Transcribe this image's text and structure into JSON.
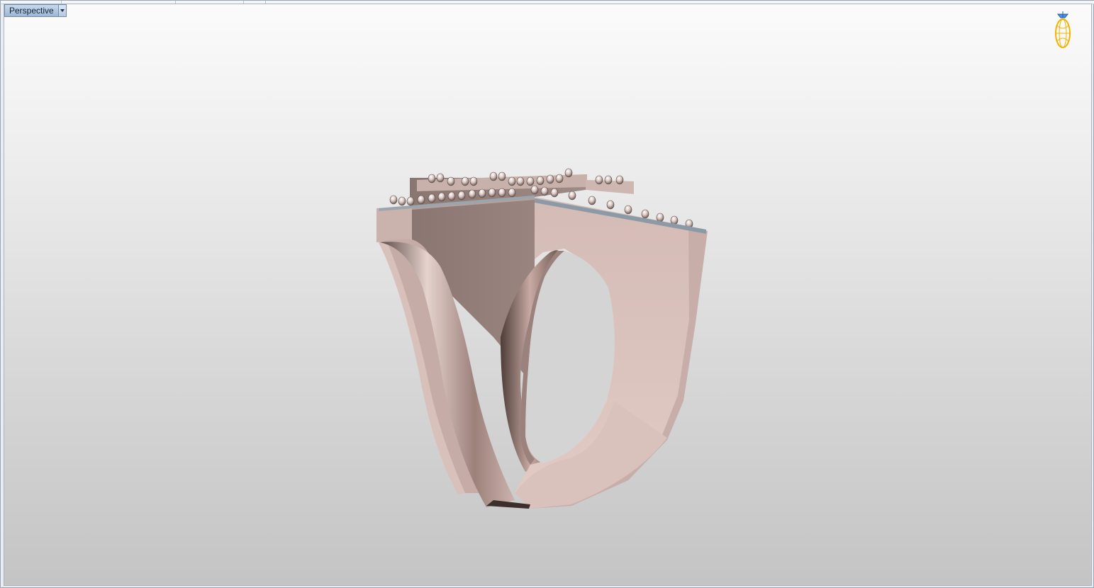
{
  "viewport": {
    "title": "Perspective",
    "dropdown_icon": "chevron-down-icon",
    "gumball_icon": "ring-gumball-icon",
    "model": "ring-3d-model"
  },
  "colors": {
    "metal_light": "#dcc3bd",
    "metal_mid": "#b89f9a",
    "metal_dark": "#6e5955",
    "tab_bg": "#a8bdd6",
    "gumball": "#f0b400"
  }
}
